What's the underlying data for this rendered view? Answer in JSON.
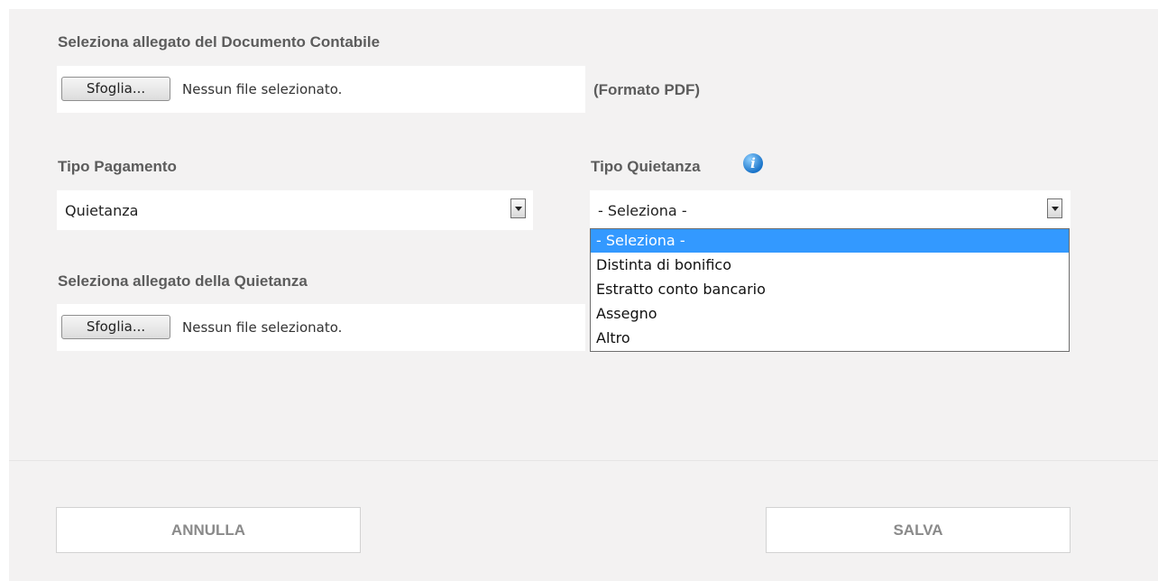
{
  "document_attachment": {
    "label": "Seleziona allegato del Documento Contabile",
    "browse_label": "Sfoglia...",
    "file_status": "Nessun file selezionato.",
    "format_note": "(Formato PDF)"
  },
  "payment_type": {
    "label": "Tipo Pagamento",
    "selected": "Quietanza"
  },
  "receipt_type": {
    "label": "Tipo Quietanza",
    "info_icon": "info-icon",
    "selected": "- Seleziona -",
    "options": [
      "- Seleziona -",
      "Distinta di bonifico",
      "Estratto conto bancario",
      "Assegno",
      "Altro"
    ],
    "highlighted_index": 0,
    "highlight_color": "#3399ff"
  },
  "receipt_attachment": {
    "label": "Seleziona allegato della Quietanza",
    "browse_label": "Sfoglia...",
    "file_status": "Nessun file selezionato."
  },
  "actions": {
    "cancel_label": "ANNULLA",
    "save_label": "SALVA"
  }
}
